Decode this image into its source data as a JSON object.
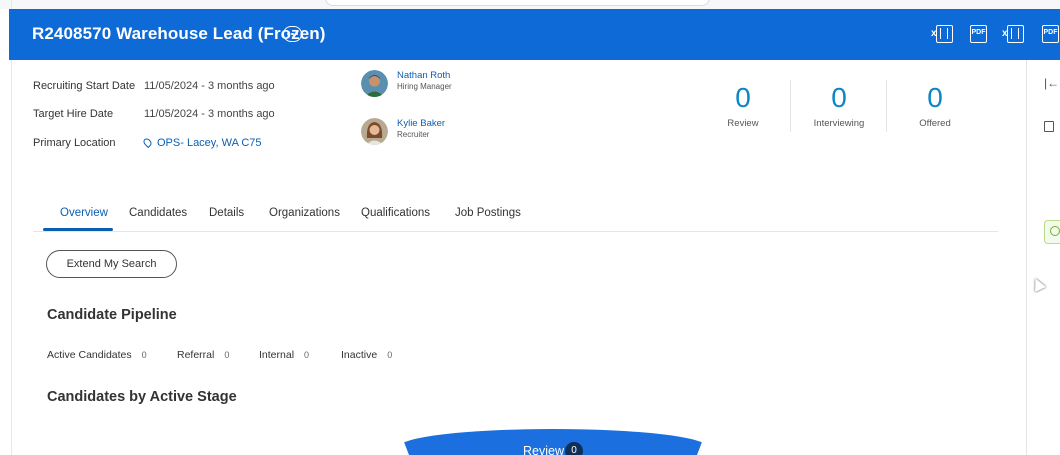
{
  "header": {
    "title": "R2408570 Warehouse Lead (Frozen)",
    "icons": [
      "more-options-icon",
      "excel-export-icon",
      "pdf-export-icon",
      "excel-export-icon",
      "pdf-export-icon"
    ],
    "color": "#0d6ad6"
  },
  "info": {
    "recruiting_start_label": "Recruiting Start Date",
    "recruiting_start_value": "11/05/2024 - 3 months ago",
    "target_hire_label": "Target Hire Date",
    "target_hire_value": "11/05/2024 - 3 months ago",
    "primary_location_label": "Primary Location",
    "primary_location_value": "OPS- Lacey, WA C75"
  },
  "people": [
    {
      "name": "Nathan Roth",
      "role": "Hiring Manager"
    },
    {
      "name": "Kylie Baker",
      "role": "Recruiter"
    }
  ],
  "stats": [
    {
      "value": "0",
      "label": "Review"
    },
    {
      "value": "0",
      "label": "Interviewing"
    },
    {
      "value": "0",
      "label": "Offered"
    }
  ],
  "tabs": [
    "Overview",
    "Candidates",
    "Details",
    "Organizations",
    "Qualifications",
    "Job Postings"
  ],
  "active_tab": "Overview",
  "extend_button": "Extend My Search",
  "pipeline": {
    "title": "Candidate Pipeline",
    "items": [
      {
        "label": "Active Candidates",
        "count": "0"
      },
      {
        "label": "Referral",
        "count": "0"
      },
      {
        "label": "Internal",
        "count": "0"
      },
      {
        "label": "Inactive",
        "count": "0"
      }
    ]
  },
  "stage": {
    "title": "Candidates by Active Stage",
    "funnel_label": "Review",
    "funnel_count": "0"
  },
  "colors": {
    "accent": "#0b5fb3",
    "stat_number": "#0d86c8",
    "funnel": "#1b6fde"
  }
}
